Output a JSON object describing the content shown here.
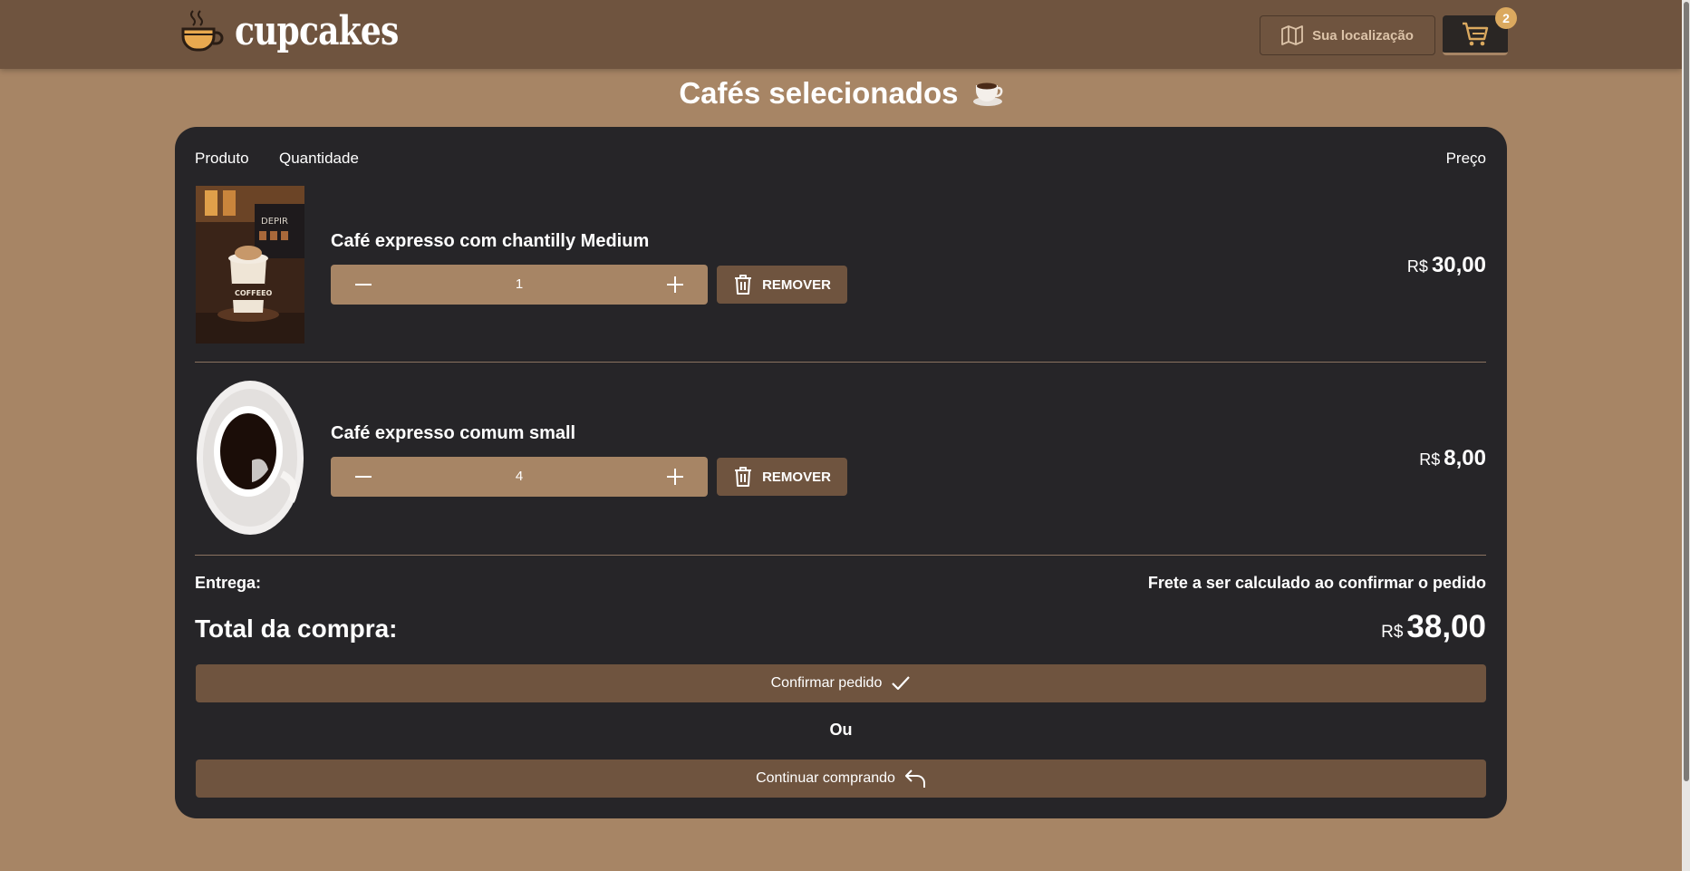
{
  "header": {
    "logo_text": "cupcakes",
    "location_label": "Sua localização",
    "cart_count": "2"
  },
  "page_title": "Cafés selecionados",
  "table": {
    "col_product": "Produto",
    "col_quantity": "Quantidade",
    "col_price": "Preço"
  },
  "items": [
    {
      "name": "Café expresso com chantilly Medium",
      "quantity": "1",
      "remove_label": "REMOVER",
      "currency": "R$",
      "price": "30,00"
    },
    {
      "name": "Café expresso comum small",
      "quantity": "4",
      "remove_label": "REMOVER",
      "currency": "R$",
      "price": "8,00"
    }
  ],
  "summary": {
    "delivery_label": "Entrega:",
    "delivery_note": "Frete a ser calculado ao confirmar o pedido",
    "total_label": "Total da compra:",
    "total_currency": "R$",
    "total_value": "38,00"
  },
  "actions": {
    "confirm_label": "Confirmar pedido",
    "or_label": "Ou",
    "continue_label": "Continuar comprando"
  },
  "colors": {
    "background": "#a78565",
    "header": "#6f543f",
    "panel": "#262528",
    "accent": "#dba95f"
  }
}
